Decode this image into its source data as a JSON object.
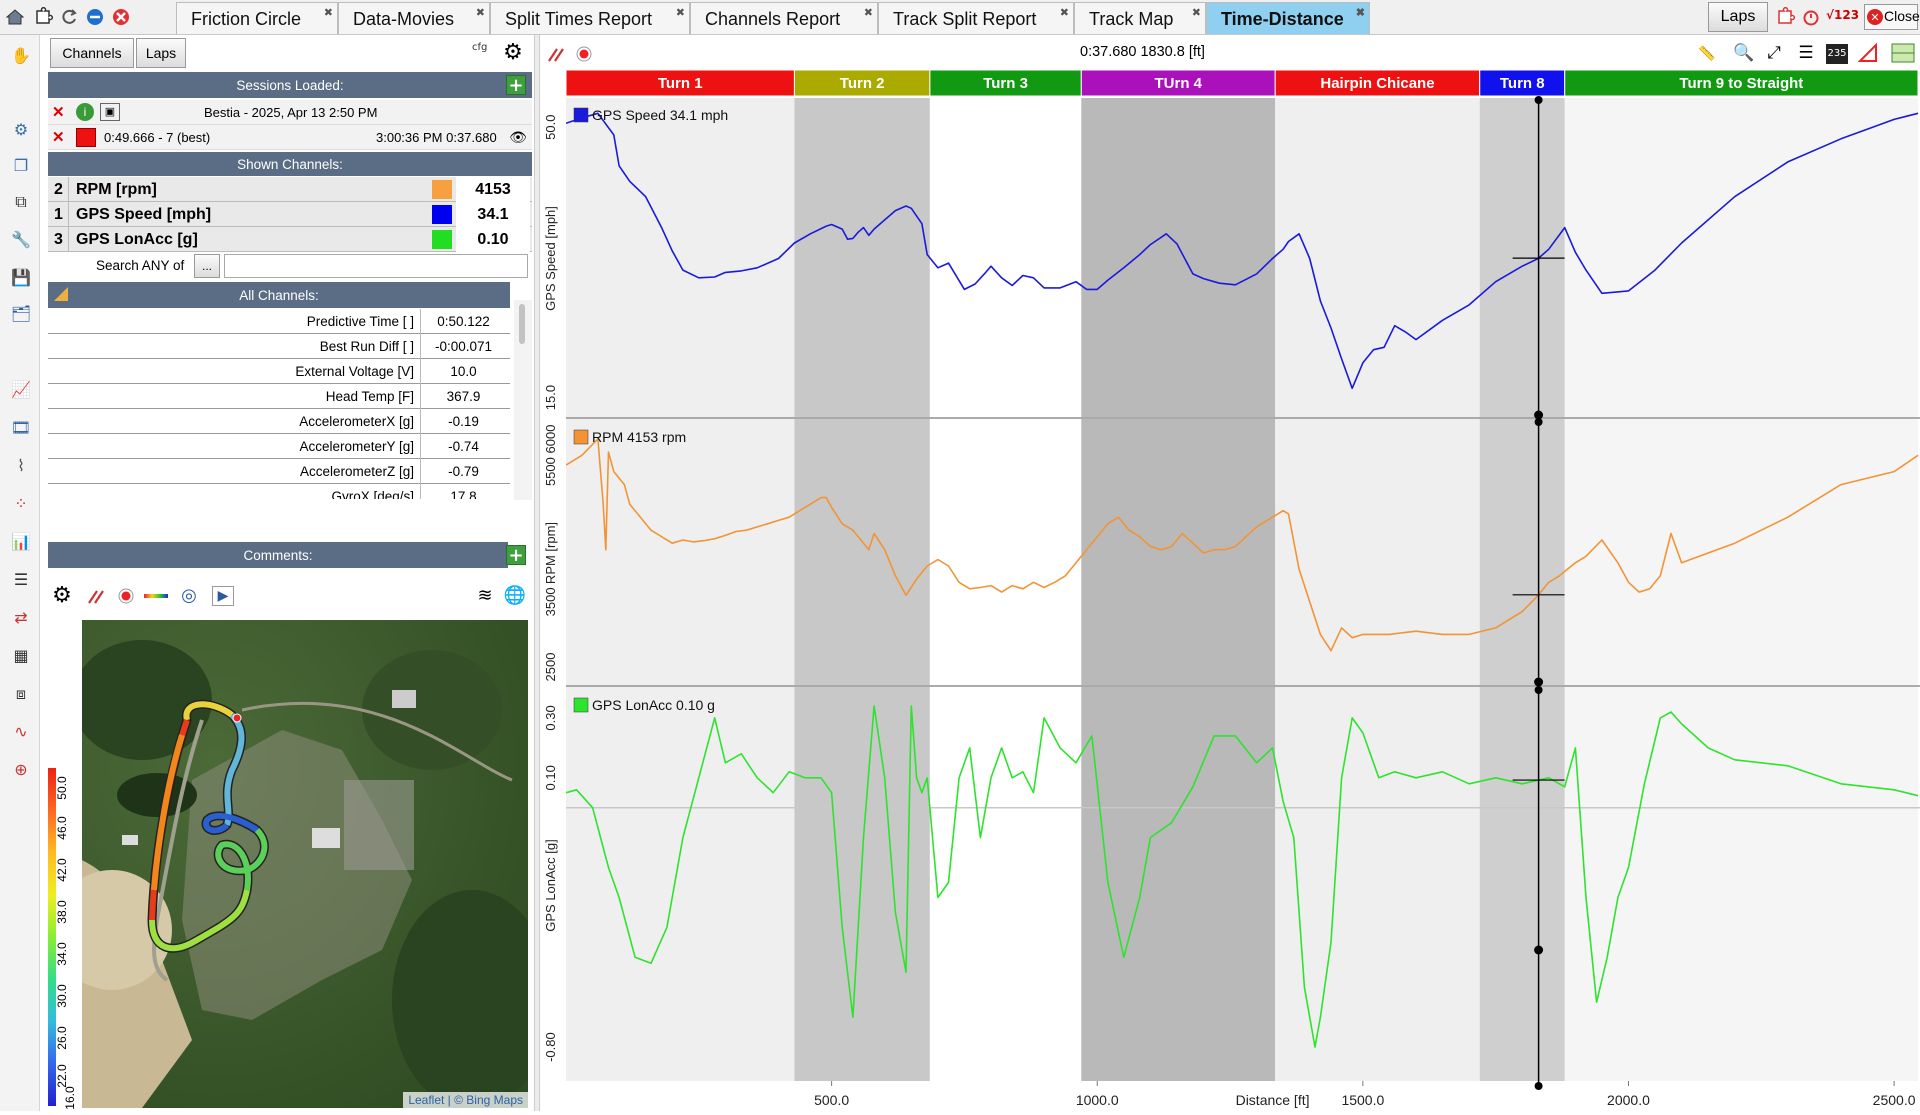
{
  "tabs": [
    {
      "label": "Friction Circle",
      "active": false
    },
    {
      "label": "Data-Movies",
      "active": false
    },
    {
      "label": "Split Times Report",
      "active": false
    },
    {
      "label": "Channels Report",
      "active": false
    },
    {
      "label": "Track Split Report",
      "active": false
    },
    {
      "label": "Track Map",
      "active": false
    },
    {
      "label": "Time-Distance",
      "active": true
    }
  ],
  "topright": {
    "laps_label": "Laps",
    "close_label": "Close",
    "v123_label": "√123"
  },
  "panel": {
    "channels_btn": "Channels",
    "laps_btn": "Laps",
    "cfg_label": "cfg",
    "sessions_header": "Sessions Loaded:",
    "session_name": "Bestia - 2025, Apr 13 2:50 PM",
    "lap_info": "0:49.666 - 7 (best)",
    "lap_time": "3:00:36 PM 0:37.680",
    "shown_header": "Shown Channels:",
    "search_label": "Search ANY of",
    "search_btn": "...",
    "search_value": "",
    "all_header": "All Channels:",
    "comments_header": "Comments:",
    "lap_color": "#ee1111"
  },
  "shown_channels": [
    {
      "num": "2",
      "name": "RPM [rpm]",
      "color": "#f7a040",
      "value": "4153"
    },
    {
      "num": "1",
      "name": "GPS Speed [mph]",
      "color": "#0000ee",
      "value": "34.1"
    },
    {
      "num": "3",
      "name": "GPS LonAcc [g]",
      "color": "#22dd22",
      "value": "0.10"
    }
  ],
  "all_channels": [
    {
      "name": "Predictive Time [ ]",
      "value": "0:50.122"
    },
    {
      "name": "Best Run Diff [ ]",
      "value": "-0:00.071"
    },
    {
      "name": "External Voltage [V]",
      "value": "10.0"
    },
    {
      "name": "Head Temp [F]",
      "value": "367.9"
    },
    {
      "name": "AccelerometerX [g]",
      "value": "-0.19"
    },
    {
      "name": "AccelerometerY [g]",
      "value": "-0.74"
    },
    {
      "name": "AccelerometerZ [g]",
      "value": "-0.79"
    },
    {
      "name": "GyroX [deg/s]",
      "value": "17.8"
    }
  ],
  "map": {
    "attribution": "Leaflet | © Bing Maps",
    "scale_labels": [
      "50.0",
      "46.0",
      "42.0",
      "38.0",
      "34.0",
      "30.0",
      "26.0",
      "22.0",
      "16.0"
    ]
  },
  "chart_header": {
    "cursor_readout": "0:37.680 1830.8 [ft]"
  },
  "segments": [
    {
      "label": "Turn 1",
      "color": "#ee1111",
      "start": 0,
      "end": 430
    },
    {
      "label": "Turn 2",
      "color": "#aaaa00",
      "start": 430,
      "end": 685
    },
    {
      "label": "Turn 3",
      "color": "#119911",
      "start": 685,
      "end": 970
    },
    {
      "label": "TUrn 4",
      "color": "#aa11bb",
      "start": 970,
      "end": 1335
    },
    {
      "label": "Hairpin Chicane",
      "color": "#ee1111",
      "start": 1335,
      "end": 1720
    },
    {
      "label": "Turn 8",
      "color": "#1111ee",
      "start": 1720,
      "end": 1880
    },
    {
      "label": "Turn 9 to Straight",
      "color": "#119911",
      "start": 1880,
      "end": 2545
    }
  ],
  "chart_data": {
    "type": "line",
    "xlabel": "Distance [ft]",
    "xlim": [
      0,
      2545
    ],
    "x_ticks": [
      500,
      1000,
      1500,
      2000,
      2500
    ],
    "x_tick_labels": [
      "500.0",
      "1000.0",
      "1500.0",
      "2000.0",
      "2500.0"
    ],
    "cursor_x": 1830.8,
    "panels": [
      {
        "name": "GPS Speed",
        "legend": "GPS Speed  34.1  mph",
        "ylabel": "GPS Speed [mph]",
        "color": "#1a1adc",
        "ylim": [
          13,
          53
        ],
        "yticks": [
          15,
          50
        ],
        "ytick_labels": [
          "15.0",
          "50.0"
        ],
        "x": [
          0,
          30,
          60,
          90,
          100,
          120,
          150,
          180,
          200,
          220,
          250,
          280,
          300,
          330,
          360,
          400,
          430,
          460,
          490,
          500,
          520,
          530,
          540,
          550,
          560,
          570,
          580,
          600,
          620,
          640,
          650,
          670,
          680,
          700,
          720,
          750,
          770,
          790,
          800,
          820,
          840,
          860,
          880,
          900,
          930,
          960,
          980,
          1000,
          1020,
          1050,
          1080,
          1100,
          1130,
          1150,
          1180,
          1200,
          1230,
          1260,
          1300,
          1330,
          1350,
          1360,
          1380,
          1400,
          1420,
          1440,
          1460,
          1480,
          1500,
          1520,
          1540,
          1560,
          1580,
          1600,
          1650,
          1700,
          1750,
          1800,
          1830,
          1850,
          1880,
          1900,
          1920,
          1950,
          2000,
          2050,
          2100,
          2200,
          2300,
          2400,
          2500,
          2545
        ],
        "y": [
          50.5,
          51.2,
          51.8,
          49,
          45,
          43,
          41,
          37,
          34,
          31.5,
          30.5,
          30.6,
          31.2,
          31.4,
          31.8,
          33,
          35,
          36.2,
          37.2,
          37.4,
          36.8,
          35.5,
          35.6,
          36.4,
          37.0,
          36.0,
          36.8,
          38.0,
          39.2,
          39.8,
          39.5,
          37.5,
          33.5,
          31.8,
          32.4,
          29.0,
          29.7,
          31.2,
          32.0,
          30.5,
          29.5,
          30.8,
          30.5,
          29.2,
          29.2,
          30.0,
          29.0,
          29.0,
          30.2,
          31.8,
          33.5,
          34.8,
          36.2,
          34.9,
          31.0,
          30.4,
          29.8,
          29.6,
          31.0,
          33.0,
          34.2,
          35.2,
          36.2,
          33.0,
          27.5,
          24,
          20,
          16.2,
          19.5,
          21.2,
          21.5,
          24.3,
          23.5,
          22.5,
          25,
          27,
          30,
          32,
          33,
          34.2,
          37,
          33.8,
          31.5,
          28.5,
          28.8,
          31.5,
          35,
          41,
          45.5,
          48.5,
          51,
          51.8
        ]
      },
      {
        "name": "RPM",
        "legend": "RPM  4153  rpm",
        "ylabel": "RPM [rpm]",
        "color": "#f29436",
        "ylim": [
          2300,
          6200
        ],
        "yticks": [
          2500,
          3500,
          5500,
          6000
        ],
        "ytick_labels": [
          "2500",
          "3500",
          "5500",
          "6000"
        ],
        "x": [
          0,
          30,
          60,
          70,
          75,
          80,
          90,
          100,
          110,
          120,
          140,
          160,
          180,
          200,
          220,
          240,
          260,
          280,
          300,
          320,
          340,
          360,
          380,
          400,
          420,
          440,
          460,
          480,
          490,
          500,
          520,
          540,
          560,
          570,
          580,
          600,
          620,
          640,
          660,
          680,
          700,
          720,
          740,
          760,
          780,
          800,
          820,
          840,
          860,
          880,
          900,
          920,
          940,
          960,
          980,
          1000,
          1020,
          1040,
          1060,
          1080,
          1100,
          1120,
          1140,
          1160,
          1180,
          1200,
          1220,
          1240,
          1260,
          1280,
          1300,
          1330,
          1350,
          1360,
          1380,
          1400,
          1420,
          1440,
          1460,
          1480,
          1500,
          1550,
          1600,
          1650,
          1700,
          1750,
          1800,
          1830,
          1850,
          1870,
          1900,
          1920,
          1950,
          1980,
          2000,
          2020,
          2040,
          2050,
          2060,
          2080,
          2100,
          2200,
          2300,
          2400,
          2500,
          2545
        ],
        "y": [
          5600,
          5750,
          6000,
          5000,
          4300,
          5800,
          5500,
          5400,
          5300,
          5000,
          4800,
          4600,
          4500,
          4400,
          4450,
          4420,
          4440,
          4470,
          4520,
          4580,
          4600,
          4650,
          4700,
          4750,
          4800,
          4900,
          5000,
          5100,
          5100,
          4950,
          4700,
          4600,
          4400,
          4300,
          4550,
          4300,
          3900,
          3600,
          3850,
          4050,
          4150,
          4050,
          3800,
          3700,
          3720,
          3750,
          3650,
          3750,
          3700,
          3800,
          3720,
          3800,
          3900,
          4100,
          4300,
          4500,
          4700,
          4800,
          4600,
          4500,
          4350,
          4300,
          4350,
          4550,
          4400,
          4250,
          4300,
          4300,
          4350,
          4500,
          4650,
          4800,
          4900,
          4850,
          4000,
          3500,
          3000,
          2750,
          3100,
          2950,
          3000,
          3000,
          3050,
          3000,
          3000,
          3100,
          3350,
          3600,
          3800,
          3900,
          4100,
          4200,
          4450,
          4100,
          3800,
          3650,
          3700,
          3800,
          3900,
          4550,
          4100,
          4400,
          4800,
          5300,
          5500,
          5750,
          5900
        ]
      },
      {
        "name": "GPS LonAcc",
        "legend": "GPS LonAcc  0.10  g",
        "ylabel": "GPS LonAcc [g]",
        "color": "#2ee32e",
        "ylim": [
          -0.9,
          0.38
        ],
        "yticks": [
          -0.8,
          0.1,
          0.3
        ],
        "ytick_labels": [
          "-0.80",
          "0.10",
          "0.30"
        ],
        "x": [
          0,
          20,
          50,
          80,
          100,
          130,
          160,
          190,
          220,
          250,
          280,
          300,
          330,
          360,
          390,
          420,
          450,
          480,
          500,
          520,
          540,
          560,
          580,
          600,
          620,
          640,
          650,
          660,
          670,
          680,
          700,
          720,
          740,
          760,
          780,
          800,
          820,
          840,
          860,
          880,
          900,
          930,
          960,
          990,
          1020,
          1050,
          1080,
          1100,
          1140,
          1180,
          1220,
          1260,
          1300,
          1330,
          1350,
          1370,
          1390,
          1410,
          1420,
          1440,
          1460,
          1480,
          1500,
          1530,
          1560,
          1600,
          1650,
          1700,
          1750,
          1800,
          1850,
          1880,
          1900,
          1920,
          1940,
          1960,
          1980,
          2000,
          2030,
          2060,
          2080,
          2100,
          2150,
          2200,
          2300,
          2400,
          2500,
          2545
        ],
        "y": [
          0.05,
          0.06,
          0.0,
          -0.2,
          -0.3,
          -0.5,
          -0.52,
          -0.4,
          -0.1,
          0.1,
          0.3,
          0.15,
          0.18,
          0.1,
          0.05,
          0.12,
          0.1,
          0.1,
          0.05,
          -0.4,
          -0.7,
          -0.1,
          0.34,
          0.1,
          -0.35,
          -0.55,
          0.34,
          0.1,
          0.05,
          0.1,
          -0.3,
          -0.25,
          0.1,
          0.2,
          -0.1,
          0.1,
          0.2,
          0.1,
          0.12,
          0.05,
          0.3,
          0.2,
          0.15,
          0.24,
          -0.25,
          -0.5,
          -0.3,
          -0.1,
          -0.05,
          0.07,
          0.24,
          0.24,
          0.15,
          0.2,
          0.02,
          -0.1,
          -0.6,
          -0.8,
          -0.7,
          -0.45,
          0.1,
          0.3,
          0.25,
          0.1,
          0.12,
          0.1,
          0.12,
          0.08,
          0.1,
          0.08,
          0.1,
          0.07,
          0.2,
          -0.3,
          -0.65,
          -0.5,
          -0.3,
          -0.2,
          0.08,
          0.3,
          0.32,
          0.28,
          0.2,
          0.16,
          0.14,
          0.08,
          0.06,
          0.04
        ]
      }
    ]
  }
}
